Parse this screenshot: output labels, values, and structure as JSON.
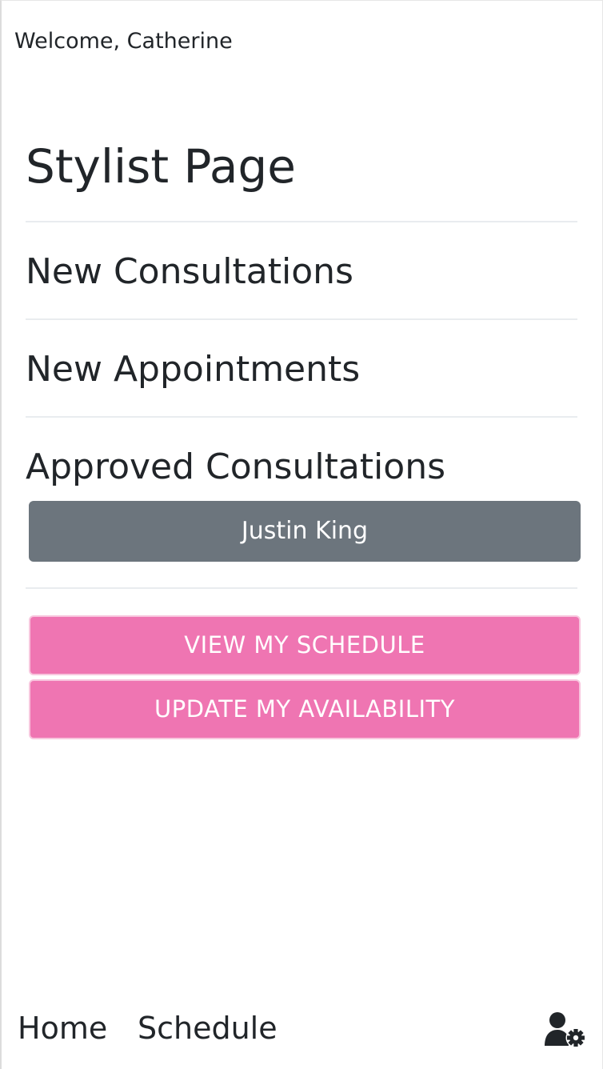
{
  "header": {
    "welcome": "Welcome, Catherine"
  },
  "main": {
    "title": "Stylist Page",
    "sections": [
      {
        "heading": "New Consultations"
      },
      {
        "heading": "New Appointments"
      },
      {
        "heading": "Approved Consultations",
        "items": [
          "Justin King"
        ]
      }
    ],
    "actions": {
      "view_schedule": "VIEW MY SCHEDULE",
      "update_availability": "UPDATE MY AVAILABILITY"
    }
  },
  "nav": {
    "home": "Home",
    "schedule": "Schedule",
    "settings_icon": "user-gear-icon"
  },
  "colors": {
    "accent_pink": "#ef75b2",
    "secondary_gray": "#6c757d",
    "text": "#212529"
  }
}
